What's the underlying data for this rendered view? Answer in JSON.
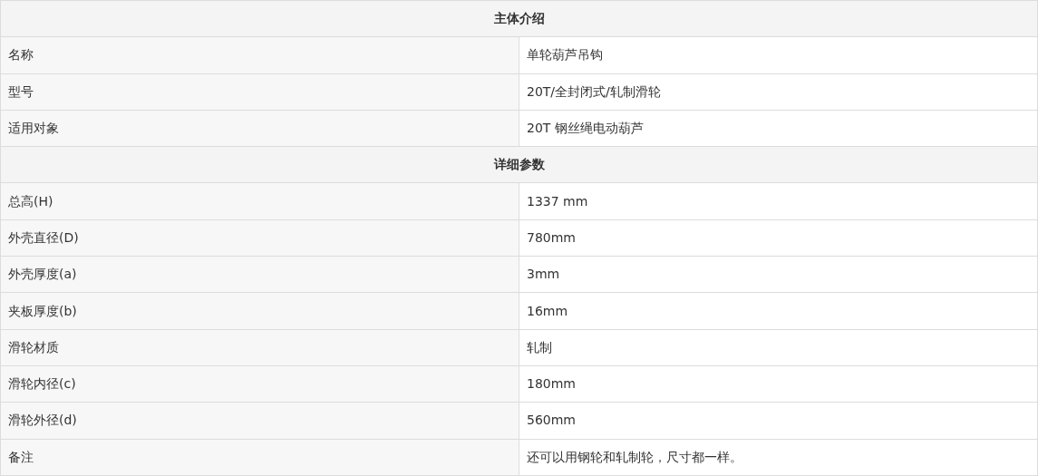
{
  "sections": [
    {
      "title": "主体介绍",
      "rows": [
        {
          "label": "名称",
          "value": "单轮葫芦吊钩"
        },
        {
          "label": "型号",
          "value": "20T/全封闭式/轧制滑轮"
        },
        {
          "label": "适用对象",
          "value": "20T 钢丝绳电动葫芦"
        }
      ]
    },
    {
      "title": "详细参数",
      "rows": [
        {
          "label": "总高(H)",
          "value": "1337 mm"
        },
        {
          "label": "外壳直径(D)",
          "value": "780mm"
        },
        {
          "label": "外壳厚度(a)",
          "value": "3mm"
        },
        {
          "label": "夹板厚度(b)",
          "value": "16mm"
        },
        {
          "label": "滑轮材质",
          "value": "轧制"
        },
        {
          "label": "滑轮内径(c)",
          "value": "180mm"
        },
        {
          "label": "滑轮外径(d)",
          "value": "560mm"
        },
        {
          "label": "备注",
          "value": "还可以用钢轮和轧制轮，尺寸都一样。"
        }
      ]
    }
  ]
}
